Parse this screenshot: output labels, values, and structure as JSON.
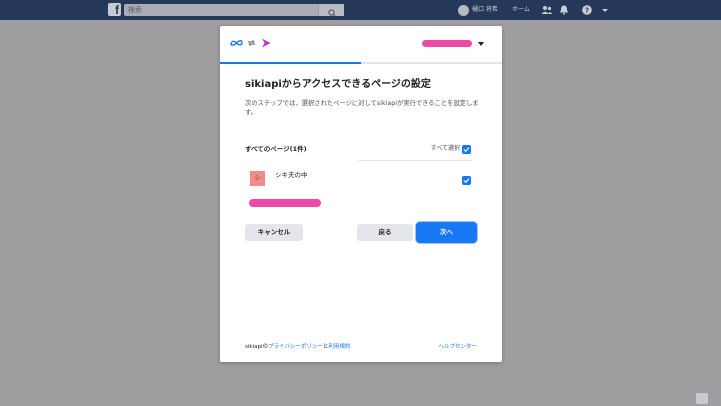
{
  "topbar": {
    "logo_letter": "f",
    "search_placeholder": "検索",
    "user_name": "樋口 将希",
    "home_label": "ホーム"
  },
  "modal": {
    "progress": 0.5,
    "title": "sikiapiからアクセスできるページの設定",
    "subtitle": "次のステップでは、選択されたページに対してsikiapiが実行できることを設定します。",
    "section_title": "すべてのページ(1件)",
    "select_all_label": "すべて選択",
    "select_all_checked": true,
    "pages": [
      {
        "thumb_text": "シ",
        "name": "シキ夫の中",
        "checked": true
      }
    ],
    "buttons": {
      "cancel": "キャンセル",
      "back": "戻る",
      "next": "次へ"
    },
    "footer": {
      "prefix": "sikiapiの",
      "privacy_link": "プライバシーポリシー",
      "conjunction": "と",
      "terms_link": "利用規約",
      "help_link": "ヘルプセンター"
    }
  },
  "colors": {
    "accent": "#1877f2",
    "topbar": "#26385a",
    "overlay": "#9e9ea0",
    "redaction": "#ec4aa6"
  },
  "icons": [
    "facebook-logo-icon",
    "search-icon",
    "friends-icon",
    "bell-icon",
    "help-icon",
    "caret-down-icon",
    "meta-logo-icon",
    "link-arrows-icon",
    "app-logo-icon",
    "checkmark-icon"
  ]
}
